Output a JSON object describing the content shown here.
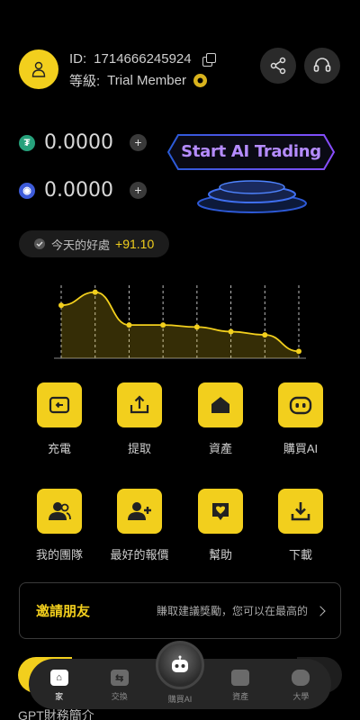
{
  "profile": {
    "id_label": "ID:",
    "id_value": "1714666245924",
    "level_label": "等級:",
    "level_value": "Trial Member"
  },
  "balances": [
    {
      "icon": "tether-icon",
      "value": "0.0000",
      "color": "#26a17b",
      "glyph": "₮"
    },
    {
      "icon": "coin-icon",
      "value": "0.0000",
      "color": "#3d5bd9",
      "glyph": "◉"
    }
  ],
  "ai_button": {
    "label": "Start AI Trading"
  },
  "earnings": {
    "label": "今天的好處",
    "value": "+91.10"
  },
  "chart_data": {
    "type": "line",
    "x": [
      0,
      1,
      2,
      3,
      4,
      5,
      6,
      7
    ],
    "y": [
      0.75,
      0.95,
      0.45,
      0.45,
      0.42,
      0.35,
      0.3,
      0.05
    ],
    "ylim": [
      0,
      1
    ],
    "grid": "vertical-dashed",
    "color": "#f2cf1d"
  },
  "grid": [
    {
      "label": "充電",
      "icon": "deposit-icon"
    },
    {
      "label": "提取",
      "icon": "withdraw-icon"
    },
    {
      "label": "資產",
      "icon": "assets-icon"
    },
    {
      "label": "購買AI",
      "icon": "robot-icon"
    },
    {
      "label": "我的團隊",
      "icon": "team-icon"
    },
    {
      "label": "最好的報價",
      "icon": "add-user-icon"
    },
    {
      "label": "幫助",
      "icon": "help-icon"
    },
    {
      "label": "下載",
      "icon": "download-icon"
    }
  ],
  "invite": {
    "title": "邀請朋友",
    "desc": "賺取建議獎勵，您可以在最高的"
  },
  "nav": [
    {
      "label": "家",
      "icon": "home-icon",
      "active": true
    },
    {
      "label": "交換",
      "icon": "exchange-icon"
    },
    {
      "label": "購買AI",
      "icon": "robot-icon"
    },
    {
      "label": "資產",
      "icon": "wallet-icon"
    },
    {
      "label": "大學",
      "icon": "chat-icon"
    }
  ],
  "footer": {
    "text": "GPT財務簡介"
  },
  "colors": {
    "accent": "#f2cf1d",
    "background": "#000000"
  }
}
